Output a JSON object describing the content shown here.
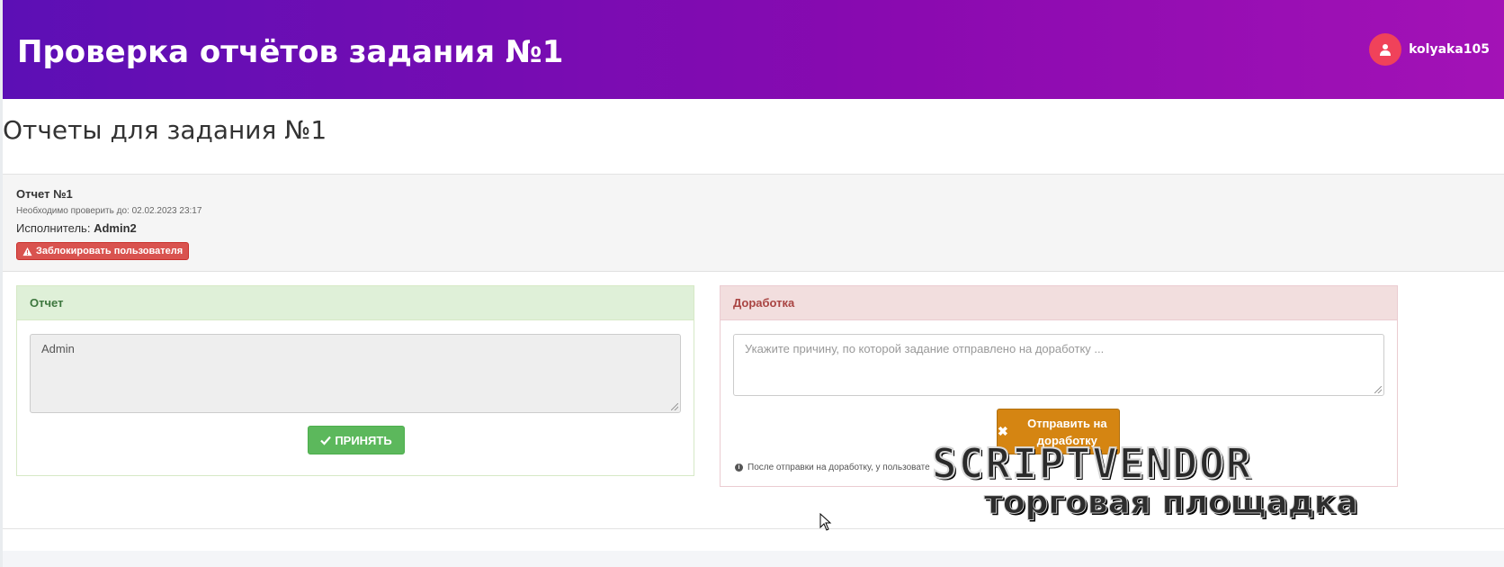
{
  "header": {
    "title": "Проверка отчётов задания №1",
    "username": "kolyaka105",
    "avatar_icon": "user-icon",
    "gradient_colors": [
      "#5c0fb5",
      "#a312b6"
    ]
  },
  "page": {
    "heading": "Отчеты для задания №1"
  },
  "report": {
    "title": "Отчет №1",
    "deadline": "Необходимо проверить до: 02.02.2023 23:17",
    "performer_label": "Исполнитель:",
    "performer_name": "Admin2",
    "block_button": "Заблокировать пользователя",
    "block_icon": "warning-icon"
  },
  "report_panel": {
    "title": "Отчет",
    "content": "Admin",
    "accept_button": "ПРИНЯТЬ",
    "accept_icon": "check-icon",
    "color": "#5cb85c"
  },
  "revision_panel": {
    "title": "Доработка",
    "placeholder": "Укажите причину, по которой задание отправлено на доработку ...",
    "send_button": "Отправить на доработку",
    "send_icon": "close-icon",
    "note": "После отправки на доработку, у пользовате",
    "color": "#d58512"
  },
  "watermark": {
    "line1": "SCRIPTVENDOR",
    "line2": "торговая площадка"
  }
}
